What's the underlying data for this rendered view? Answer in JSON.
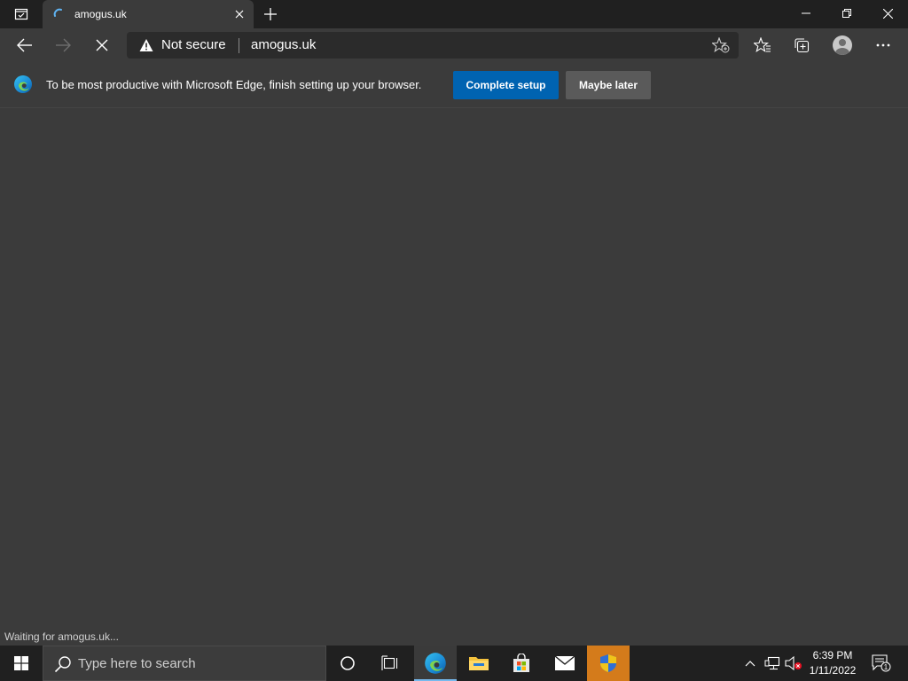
{
  "tab": {
    "title": "amogus.uk"
  },
  "address_bar": {
    "security_label": "Not secure",
    "url": "amogus.uk"
  },
  "infobar": {
    "message": "To be most productive with Microsoft Edge, finish setting up your browser.",
    "primary_label": "Complete setup",
    "secondary_label": "Maybe later"
  },
  "status": {
    "text": "Waiting for amogus.uk..."
  },
  "taskbar": {
    "search_placeholder": "Type here to search",
    "clock_time": "6:39 PM",
    "clock_date": "1/11/2022",
    "notification_count": "1"
  },
  "colors": {
    "accent_blue": "#0063b1",
    "taskbar_active_underline": "#76b9ed",
    "security_app_highlight": "#d47b1b"
  }
}
